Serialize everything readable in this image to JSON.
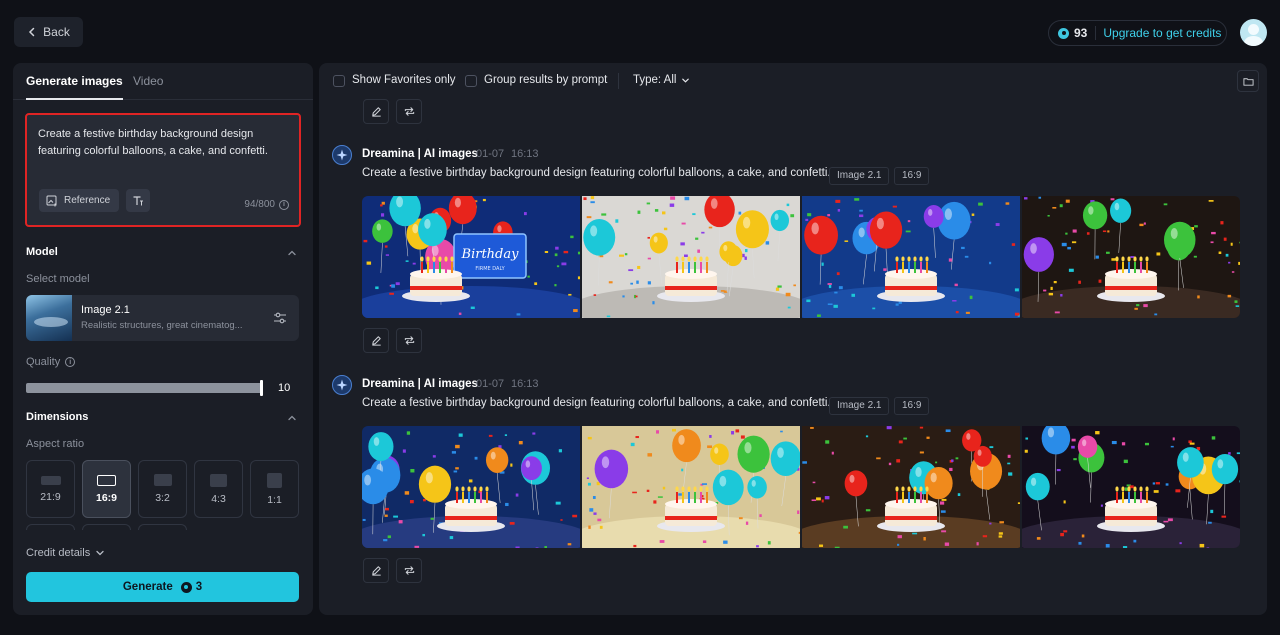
{
  "topbar": {
    "back_label": "Back",
    "credits_count": "93",
    "upgrade_label": "Upgrade to get credits"
  },
  "left_panel": {
    "tabs": [
      {
        "label": "Generate images",
        "active": true
      },
      {
        "label": "Video",
        "active": false
      }
    ],
    "prompt": {
      "text": "Create a festive birthday background design featuring colorful balloons, a cake, and confetti.",
      "reference_label": "Reference",
      "char_count": "94/800"
    },
    "model_section": {
      "title": "Model",
      "select_label": "Select model",
      "model_name": "Image 2.1",
      "model_description": "Realistic structures, great cinematog..."
    },
    "quality": {
      "label": "Quality",
      "value": "10",
      "level": 1.0
    },
    "dimensions": {
      "title": "Dimensions",
      "aspect_label": "Aspect ratio",
      "ratios": [
        {
          "label": "21:9",
          "selected": false
        },
        {
          "label": "16:9",
          "selected": true
        },
        {
          "label": "3:2",
          "selected": false
        },
        {
          "label": "4:3",
          "selected": false
        },
        {
          "label": "1:1",
          "selected": false
        }
      ]
    },
    "credit_details_label": "Credit details",
    "generate": {
      "label": "Generate",
      "cost": "3"
    }
  },
  "right_panel": {
    "toolbar": {
      "favorites_label": "Show Favorites only",
      "group_label": "Group results by prompt",
      "type_label": "Type: All"
    },
    "generations": [
      {
        "brand": "Dreamina | AI images",
        "date": "01-07",
        "time": "16:13",
        "prompt": "Create a festive birthday background design featuring colorful balloons, a cake, and confetti.",
        "tags": [
          "Image 2.1",
          "16:9"
        ],
        "images": [
          {
            "bg": "#0f2c78",
            "table": "#1a3f9c",
            "sign": "Birthday",
            "sign_sub": "FIRME DALY"
          },
          {
            "bg": "#dad8d4",
            "table": "#bdbab5"
          },
          {
            "bg": "#123a8a",
            "table": "#1c4fa8"
          },
          {
            "bg": "#1e1612",
            "table": "#3a2a22"
          }
        ]
      },
      {
        "brand": "Dreamina | AI images",
        "date": "01-07",
        "time": "16:13",
        "prompt": "Create a festive birthday background design featuring colorful balloons, a cake, and confetti.",
        "tags": [
          "Image 2.1",
          "16:9"
        ],
        "images": [
          {
            "bg": "#102a66",
            "table": "#263b80"
          },
          {
            "bg": "#d8c898",
            "table": "#e8dcae"
          },
          {
            "bg": "#2a1c14",
            "table": "#5a3c22"
          },
          {
            "bg": "#140e1c",
            "table": "#2a2238"
          }
        ]
      }
    ]
  }
}
